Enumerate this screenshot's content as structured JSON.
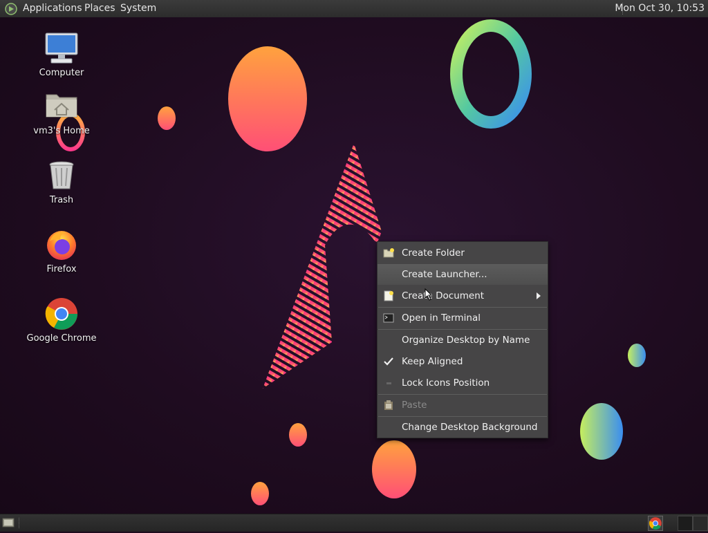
{
  "top_panel": {
    "menus": [
      "Applications",
      "Places",
      "System"
    ],
    "clock": "Mon Oct 30, 10:53"
  },
  "desktop_icons": [
    {
      "label": "Computer",
      "icon": "computer-icon"
    },
    {
      "label": "vm3's Home",
      "icon": "home-folder-icon"
    },
    {
      "label": "Trash",
      "icon": "trash-icon"
    },
    {
      "label": "Firefox",
      "icon": "firefox-icon"
    },
    {
      "label": "Google Chrome",
      "icon": "chrome-icon"
    }
  ],
  "context_menu": {
    "items": [
      {
        "label": "Create Folder",
        "icon": "new-folder-icon"
      },
      {
        "label": "Create Launcher...",
        "highlighted": true
      },
      {
        "label": "Create Document",
        "icon": "new-document-icon",
        "submenu": true
      },
      {
        "label": "Open in Terminal",
        "icon": "terminal-icon"
      },
      {
        "label": "Organize Desktop by Name"
      },
      {
        "label": "Keep Aligned",
        "checked": true,
        "icon": "checkmark-icon"
      },
      {
        "label": "Lock Icons Position",
        "icon": "unchecked-box-icon"
      },
      {
        "label": "Paste",
        "icon": "paste-icon",
        "disabled": true
      },
      {
        "label": "Change Desktop Background"
      }
    ]
  },
  "colors": {
    "panel": "#2c2c2c",
    "menu_bg": "#484848",
    "wallpaper_bg": "#1f0c20",
    "accent_orange": "#ffa040",
    "accent_pink": "#ff3d7f"
  }
}
